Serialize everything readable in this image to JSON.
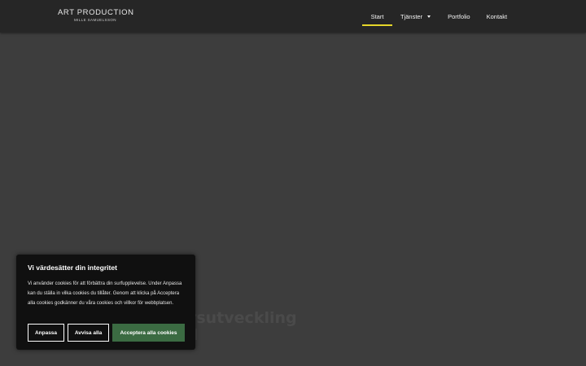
{
  "header": {
    "logo_title": "ART PRODUCTION",
    "logo_subtitle": "MILLE SAMUELSSON",
    "nav": [
      {
        "label": "Start",
        "active": true
      },
      {
        "label": "Tjänster",
        "has_dropdown": true
      },
      {
        "label": "Portfolio"
      },
      {
        "label": "Kontakt"
      }
    ],
    "active_indicator_color": "#e6d72a"
  },
  "hero": {
    "partial_heading": "rsutveckling"
  },
  "cookie_banner": {
    "title": "Vi värdesätter din integritet",
    "text": "Vi använder cookies för att förbättra din surfupplevelse. Under Anpassa kan du ställa in vilka cookies du tillåter. Genom att klicka på Acceptera alla cookies godkänner du våra cookies och villkor för webbplatsen.",
    "customize_label": "Anpassa",
    "reject_label": "Avvisa alla",
    "accept_label": "Acceptera alla cookies",
    "accept_color": "#3b6b42"
  }
}
